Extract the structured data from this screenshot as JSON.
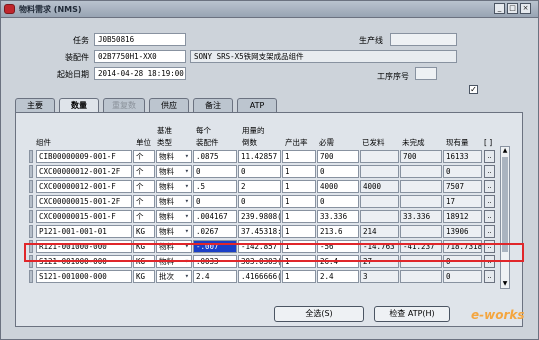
{
  "window": {
    "title": "物料需求 (NMS)"
  },
  "header": {
    "task_label": "任务",
    "task_value": "J0B50816",
    "production_line_label": "生产线",
    "production_line_value": "",
    "assembly_label": "装配件",
    "assembly_value": "02B7750H1-XX0",
    "assembly_desc": "SONY SRS-X5铁网支架成品组件",
    "start_date_label": "起始日期",
    "start_date_value": "2014-04-28 18:19:00",
    "op_seq_label": "工序序号",
    "op_seq_value": "",
    "checkbox_mark": "✓"
  },
  "tabs": [
    {
      "label": "主要",
      "state": "normal"
    },
    {
      "label": "数量",
      "state": "active"
    },
    {
      "label": "重复数量",
      "state": "disabled"
    },
    {
      "label": "供应",
      "state": "normal"
    },
    {
      "label": "备注",
      "state": "normal"
    },
    {
      "label": "ATP",
      "state": "normal"
    }
  ],
  "columns": {
    "component": "组件",
    "uom": "单位",
    "basis_type_1": "基准",
    "basis_type_2": "类型",
    "per_assembly_1": "每个",
    "per_assembly_2": "装配件",
    "usage_1": "用量的",
    "usage_2": "倒数",
    "yield": "产出率",
    "required": "必需",
    "issued": "已发料",
    "open": "未完成",
    "on_hand": "现有量",
    "more": "[ ]"
  },
  "rows": [
    {
      "component": "CIB00000009-001-F",
      "uom": "个",
      "type": "物料",
      "per": ".0875",
      "inverse": "11.42857",
      "yield": "1",
      "required": "700",
      "issued": "",
      "open": "700",
      "onhand": "16133"
    },
    {
      "component": "CXC00000012-001-2F",
      "uom": "个",
      "type": "物料",
      "per": "0",
      "inverse": "0",
      "yield": "1",
      "required": "0",
      "issued": "",
      "open": "",
      "onhand": "0"
    },
    {
      "component": "CXC00000012-001-F",
      "uom": "个",
      "type": "物料",
      "per": ".5",
      "inverse": "2",
      "yield": "1",
      "required": "4000",
      "issued": "4000",
      "open": "",
      "onhand": "7507"
    },
    {
      "component": "CXC00000015-001-2F",
      "uom": "个",
      "type": "物料",
      "per": "0",
      "inverse": "0",
      "yield": "1",
      "required": "0",
      "issued": "",
      "open": "",
      "onhand": "17"
    },
    {
      "component": "CXC00000015-001-F",
      "uom": "个",
      "type": "物料",
      "per": ".004167",
      "inverse": "239.9808(",
      "yield": "1",
      "required": "33.336",
      "issued": "",
      "open": "33.336",
      "onhand": "18912"
    },
    {
      "component": "P121-001-001-01",
      "uom": "KG",
      "type": "物料",
      "per": ".0267",
      "inverse": "37.45318:",
      "yield": "1",
      "required": "213.6",
      "issued": "214",
      "open": "",
      "onhand": "13906"
    },
    {
      "component": "R121-001000-000",
      "uom": "KG",
      "type": "物料",
      "per": "-.007",
      "inverse": "-142.857",
      "yield": "1",
      "required": "-56",
      "issued": "-14.763",
      "open": "-41.237",
      "onhand": "718.7318"
    },
    {
      "component": "S121-001000-000",
      "uom": "KG",
      "type": "物料",
      "per": ".0033",
      "inverse": "303.0303(",
      "yield": "1",
      "required": "26.4",
      "issued": "27",
      "open": "",
      "onhand": "0"
    },
    {
      "component": "S121-001000-000",
      "uom": "KG",
      "type": "批次",
      "per": "2.4",
      "inverse": ".4166666(",
      "yield": "1",
      "required": "2.4",
      "issued": "3",
      "open": "",
      "onhand": "0"
    }
  ],
  "buttons": {
    "select_all": "全选(S)",
    "view_atp": "检查 ATP(H)"
  },
  "more_label": "..",
  "watermark": "e-works"
}
